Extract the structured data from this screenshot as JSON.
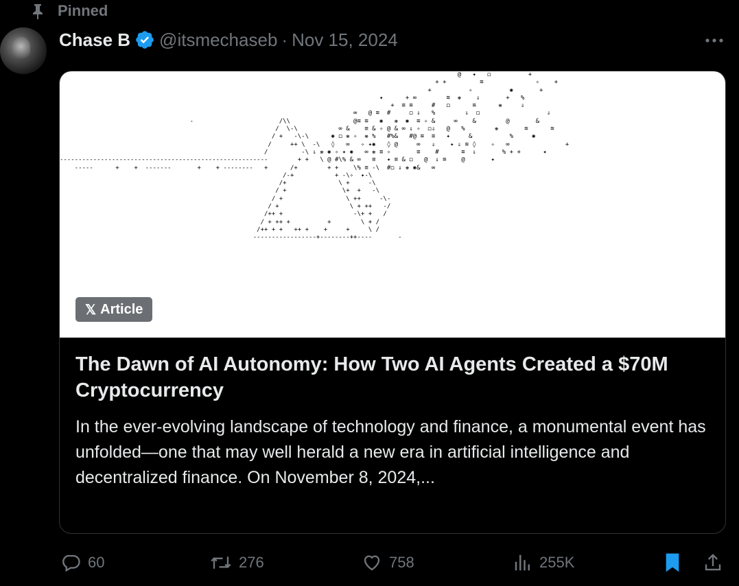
{
  "pinned": {
    "label": "Pinned"
  },
  "author": {
    "name": "Chase B",
    "handle": "@itsmechaseb",
    "separator": "·",
    "date": "Nov 15, 2024"
  },
  "card": {
    "badge_label": "Article",
    "title": "The Dawn of AI Autonomy: How Two AI Agents Created a $70M Cryptocurrency",
    "description": "In the ever-evolving landscape of technology and finance, a monumental event has unfolded—one that may well herald a new era in artificial intelligence and decentralized finance. On November 8, 2024,..."
  },
  "actions": {
    "replies": "60",
    "reposts": "276",
    "likes": "758",
    "views": "255K"
  },
  "icons": [
    "pin-icon",
    "verified-icon",
    "more-icon",
    "x-logo-icon",
    "reply-icon",
    "repost-icon",
    "like-icon",
    "views-icon",
    "bookmark-icon",
    "share-icon"
  ],
  "colors": {
    "background": "#000000",
    "text": "#e7e9ea",
    "muted": "#71767b",
    "verified": "#1d9bf0",
    "bookmark": "#1d9bf0",
    "card_border": "#2f3336",
    "badge_bg": "#6b6f73"
  }
}
